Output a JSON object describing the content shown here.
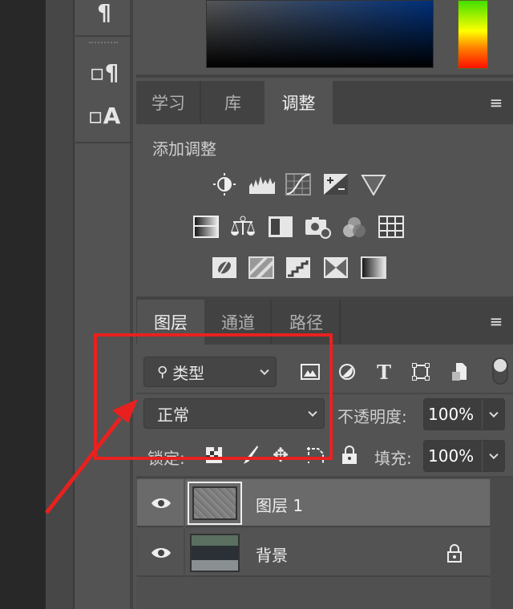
{
  "panels_top": {
    "tabs": [
      {
        "label": "学习"
      },
      {
        "label": "库"
      },
      {
        "label": "调整",
        "active": true
      }
    ]
  },
  "adjustments": {
    "title": "添加调整",
    "rows": [
      [
        "brightness-contrast-icon",
        "levels-icon",
        "curves-icon",
        "exposure-icon",
        "vibrance-icon"
      ],
      [
        "hue-saturation-icon",
        "color-balance-icon",
        "black-white-icon",
        "photo-filter-icon",
        "channel-mixer-icon",
        "color-lookup-icon"
      ],
      [
        "invert-icon",
        "posterize-icon",
        "threshold-icon",
        "selective-color-icon",
        "gradient-map-icon"
      ]
    ]
  },
  "layers_panel": {
    "tabs": [
      {
        "label": "图层",
        "active": true
      },
      {
        "label": "通道"
      },
      {
        "label": "路径"
      }
    ],
    "filter": {
      "label": "类型"
    },
    "blend_mode": "正常",
    "opacity_label": "不透明度:",
    "opacity": "100%",
    "lock_label": "锁定:",
    "fill_label": "填充:",
    "fill": "100%",
    "layers": [
      {
        "name": "图层 1",
        "selected": true,
        "visible": true
      },
      {
        "name": "背景",
        "selected": false,
        "visible": true,
        "locked": true
      }
    ]
  },
  "colors": {
    "annotation": "#e8211f",
    "panel": "#535353"
  }
}
